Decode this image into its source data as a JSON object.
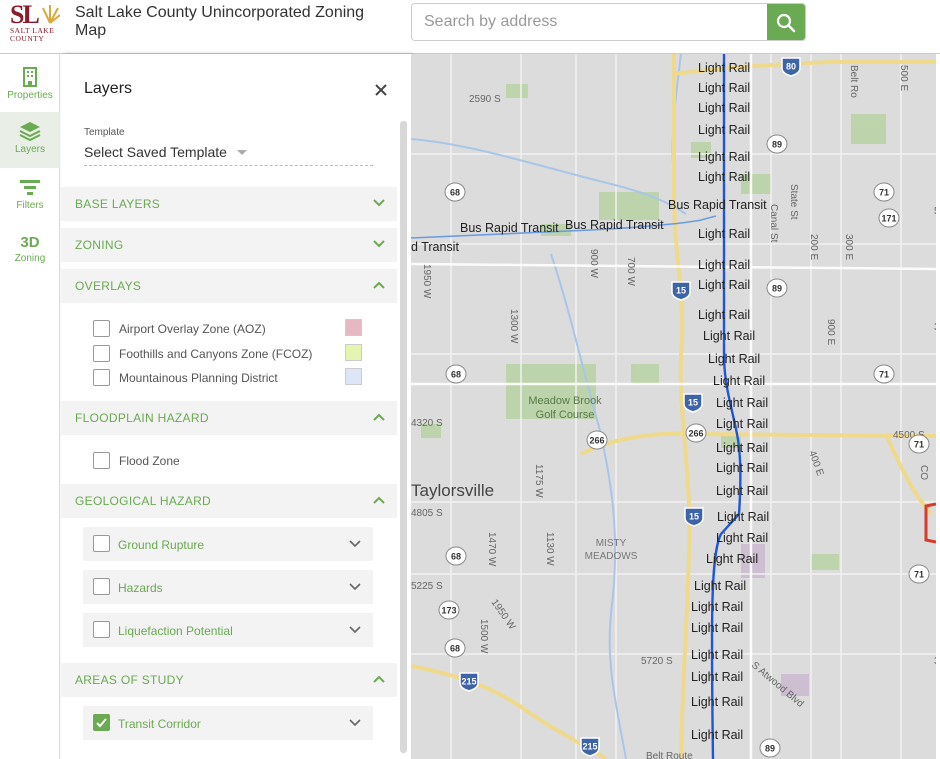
{
  "header": {
    "logo_sl": "SL",
    "logo_line1": "SALT LAKE",
    "logo_line2": "COUNTY",
    "title": "Salt Lake County Unincorporated Zoning Map",
    "search_placeholder": "Search by address"
  },
  "rail": {
    "items": [
      {
        "label": "Properties",
        "icon": "building-icon",
        "active": false
      },
      {
        "label": "Layers",
        "icon": "layers-icon",
        "active": true
      },
      {
        "label": "Filters",
        "icon": "filter-icon",
        "active": false
      },
      {
        "label": "Zoning",
        "icon_text": "3D",
        "active": false
      }
    ]
  },
  "panel": {
    "title": "Layers",
    "template_label": "Template",
    "template_value": "Select Saved Template",
    "sections": {
      "base": "BASE LAYERS",
      "zoning": "ZONING",
      "overlays": "OVERLAYS",
      "floodplain": "FLOODPLAIN HAZARD",
      "geological": "GEOLOGICAL HAZARD",
      "areas": "AREAS OF STUDY"
    },
    "overlays": [
      {
        "label": "Airport Overlay Zone (AOZ)",
        "color": "#e6b8c2"
      },
      {
        "label": "Foothills and Canyons Zone (FCOZ)",
        "color": "#e3f5b0"
      },
      {
        "label": "Mountainous Planning District",
        "color": "#dde6f7"
      }
    ],
    "floodplain": [
      {
        "label": "Flood Zone"
      }
    ],
    "geological": [
      {
        "label": "Ground Rupture"
      },
      {
        "label": "Hazards"
      },
      {
        "label": "Liquefaction Potential"
      }
    ],
    "areas": [
      {
        "label": "Transit Corridor",
        "checked": true
      }
    ]
  },
  "map": {
    "rail_label": "Light Rail",
    "brt_label": "Bus Rapid Transit",
    "brt_partial": "d Transit",
    "places": {
      "city": "Taylorsville",
      "golf1": "Meadow Brook",
      "golf2": "Golf Course",
      "misty1": "MISTY",
      "misty2": "MEADOWS"
    },
    "streets": [
      "2590 S",
      "4320 S",
      "4805 S",
      "5225 S",
      "5720 S",
      "4500 S",
      "1950 W",
      "1300 W",
      "900 W",
      "700 W",
      "1175 W",
      "1470 W",
      "1130 W",
      "1500 W",
      "1950 W",
      "Canal St",
      "State St",
      "200 E",
      "300 E",
      "500 E",
      "900 E",
      "400 E",
      "S Atwood Blvd",
      "Belt Route",
      "Belt Ro",
      "500",
      "330",
      "3",
      "CO",
      "900 E"
    ],
    "shields": [
      "80",
      "89",
      "89",
      "15",
      "15",
      "15",
      "68",
      "68",
      "68",
      "68",
      "266",
      "266",
      "71",
      "71",
      "71",
      "71",
      "171",
      "173",
      "215",
      "215",
      "89"
    ]
  },
  "colors": {
    "accent": "#6aaa52",
    "brand": "#8b1a2a",
    "rail_line": "#1f56d6"
  }
}
